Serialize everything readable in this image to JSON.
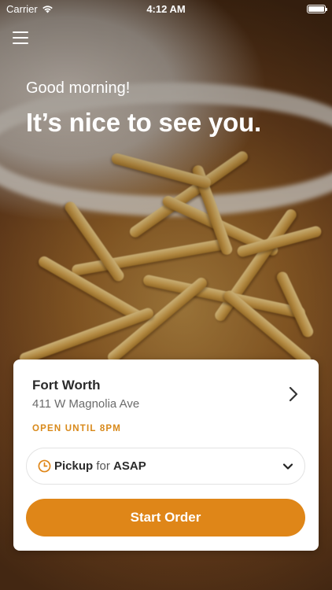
{
  "status_bar": {
    "carrier": "Carrier",
    "time": "4:12 AM",
    "battery_level": 1.0
  },
  "hero": {
    "greeting": "Good morning!",
    "headline": "It’s nice to see you."
  },
  "location": {
    "name": "Fort Worth",
    "address": "411 W Magnolia Ave",
    "hours": "OPEN UNTIL 8PM"
  },
  "order_mode": {
    "mode": "Pickup",
    "connector": "for",
    "time": "ASAP"
  },
  "actions": {
    "start_order_label": "Start Order"
  },
  "icons": {
    "menu": "hamburger-menu-icon",
    "wifi": "wifi-icon",
    "battery": "battery-icon",
    "chevron": "chevron-right-icon",
    "clock": "clock-icon",
    "dropdown": "chevron-down-icon"
  },
  "colors": {
    "accent": "#df8618",
    "hours_text": "#d8891a",
    "card_bg": "#ffffff"
  }
}
